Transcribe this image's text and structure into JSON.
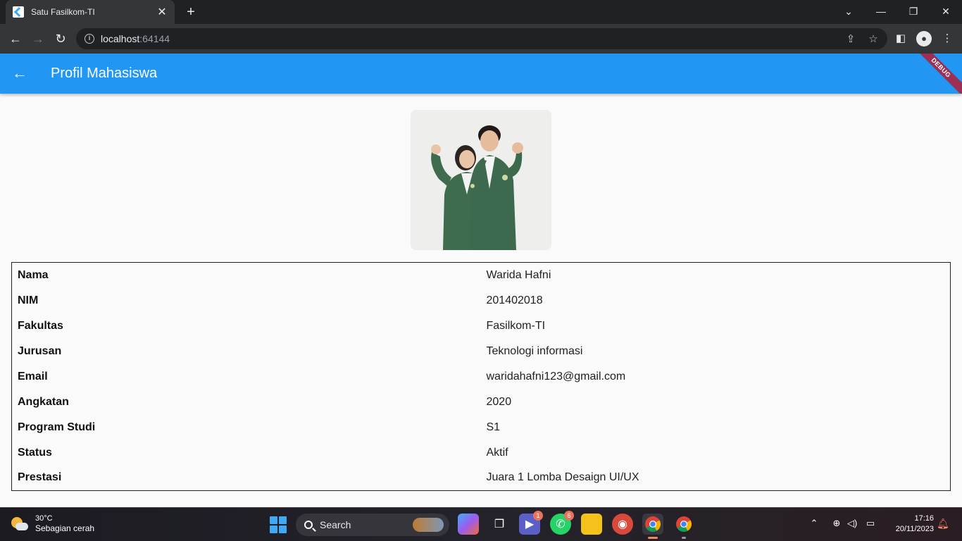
{
  "browser": {
    "tab_title": "Satu Fasilkom-TI",
    "url_host": "localhost",
    "url_port": ":64144"
  },
  "app": {
    "title": "Profil Mahasiswa",
    "debug_label": "DEBUG",
    "accent_color": "#2196f3"
  },
  "profile": {
    "rows": [
      {
        "label": "Nama",
        "value": "Warida Hafni"
      },
      {
        "label": "NIM",
        "value": "201402018"
      },
      {
        "label": "Fakultas",
        "value": "Fasilkom-TI"
      },
      {
        "label": "Jurusan",
        "value": "Teknologi informasi"
      },
      {
        "label": "Email",
        "value": "waridahafni123@gmail.com"
      },
      {
        "label": "Angkatan",
        "value": "2020"
      },
      {
        "label": "Program Studi",
        "value": "S1"
      },
      {
        "label": "Status",
        "value": "Aktif"
      },
      {
        "label": "Prestasi",
        "value": "Juara 1 Lomba Desaign UI/UX"
      }
    ]
  },
  "taskbar": {
    "weather_temp": "30°C",
    "weather_desc": "Sebagian cerah",
    "search_placeholder": "Search",
    "teams_badge": "1",
    "whatsapp_badge": "6",
    "time": "17:16",
    "date": "20/11/2023"
  }
}
